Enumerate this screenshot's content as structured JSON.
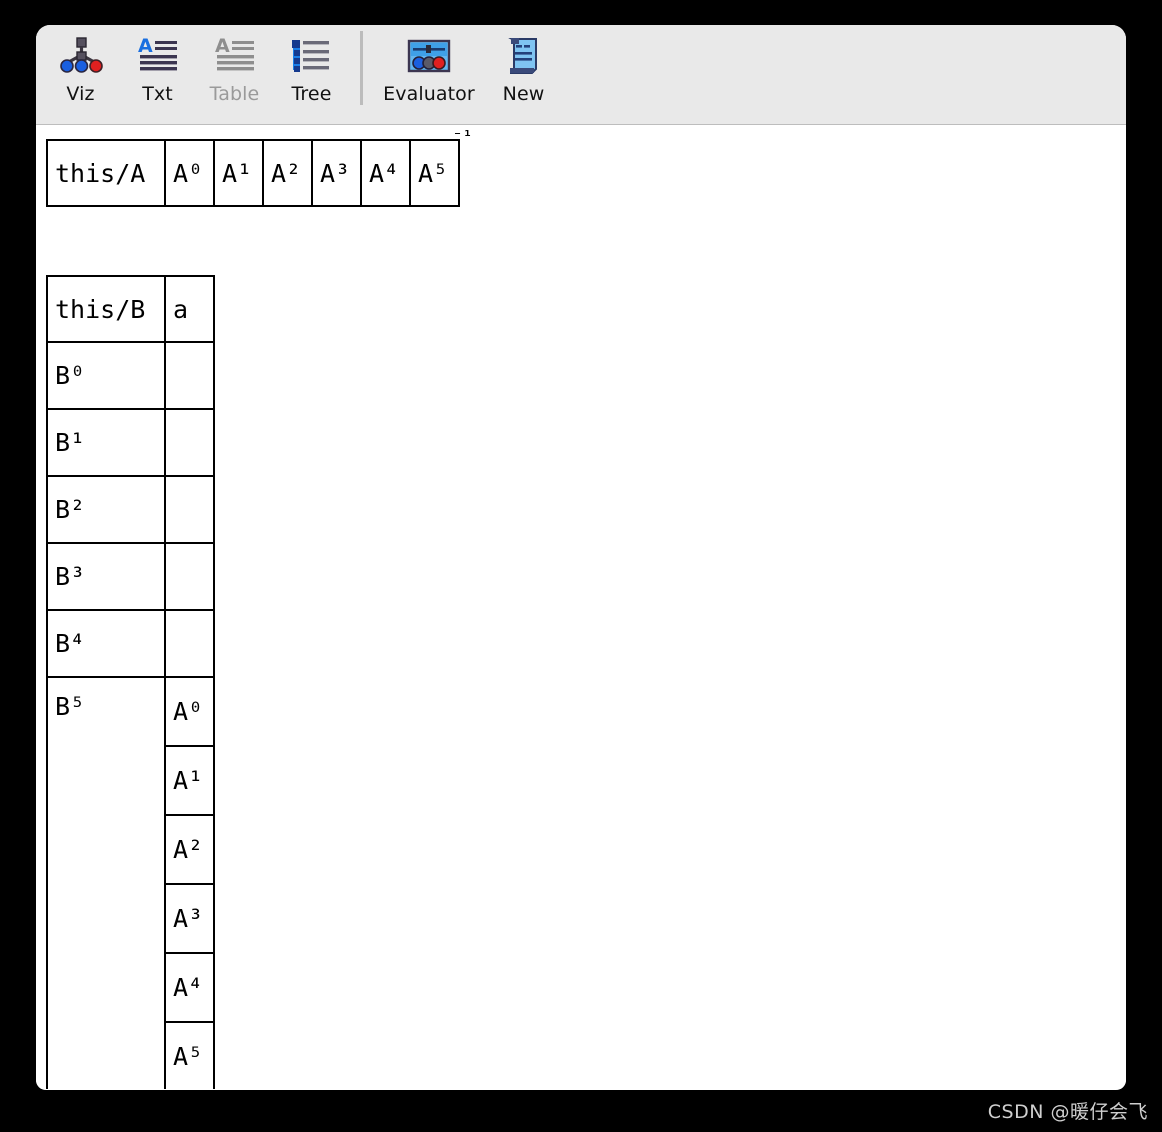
{
  "toolbar": {
    "items": [
      {
        "label": "Viz",
        "icon": "tree-graph-icon",
        "disabled": false
      },
      {
        "label": "Txt",
        "icon": "text-lines-icon",
        "disabled": false
      },
      {
        "label": "Table",
        "icon": "table-lines-icon",
        "disabled": true
      },
      {
        "label": "Tree",
        "icon": "tree-list-icon",
        "disabled": false
      },
      {
        "label": "Evaluator",
        "icon": "evaluator-icon",
        "disabled": false
      },
      {
        "label": "New",
        "icon": "scroll-new-icon",
        "disabled": false
      }
    ]
  },
  "tables": {
    "table_a": {
      "name": "table-a",
      "header": "this/A",
      "superscript_marker": "⁻¹",
      "values": [
        "A⁰",
        "A¹",
        "A²",
        "A³",
        "A⁴",
        "A⁵"
      ]
    },
    "table_b": {
      "name": "table-b",
      "header": "this/B",
      "column": "a",
      "rows": [
        {
          "label": "B⁰",
          "values": [
            ""
          ]
        },
        {
          "label": "B¹",
          "values": [
            ""
          ]
        },
        {
          "label": "B²",
          "values": [
            ""
          ]
        },
        {
          "label": "B³",
          "values": [
            ""
          ]
        },
        {
          "label": "B⁴",
          "values": [
            ""
          ]
        },
        {
          "label": "B⁵",
          "values": [
            "A⁰",
            "A¹",
            "A²",
            "A³",
            "A⁴",
            "A⁵"
          ]
        }
      ]
    }
  },
  "watermark": {
    "text": "CSDN @暖仔会飞"
  },
  "colors": {
    "toolbar_bg": "#e9e9e9",
    "content_bg": "#ffffff",
    "border": "#000000",
    "disabled_text": "#9a9a9a",
    "icon_blue": "#1a6fe0",
    "icon_red": "#e02020"
  }
}
